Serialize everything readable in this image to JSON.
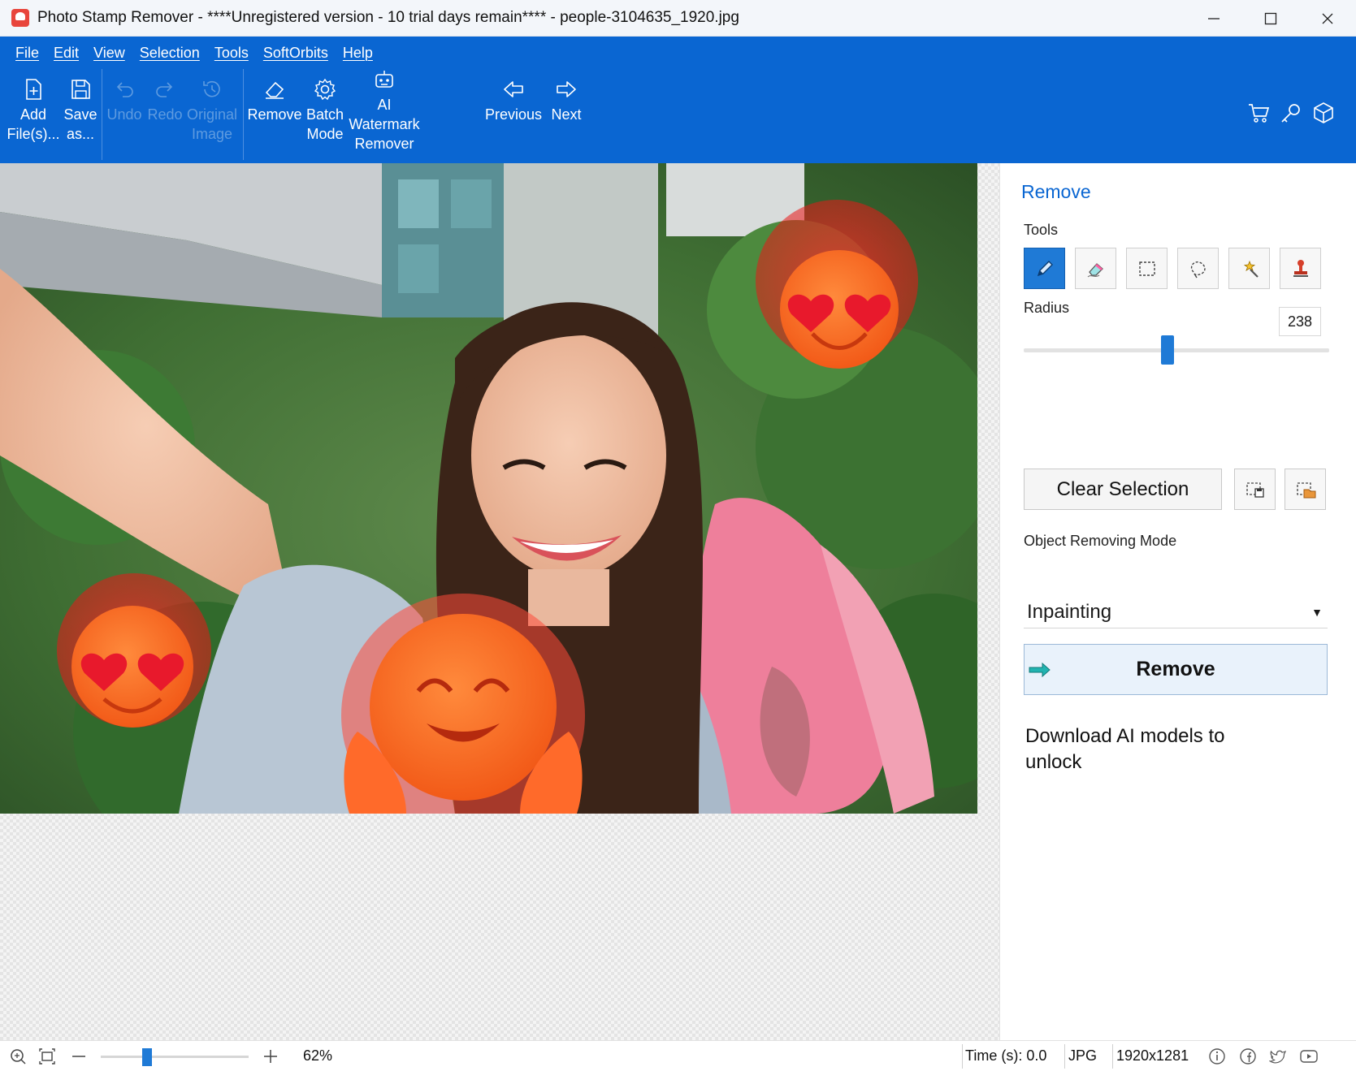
{
  "window": {
    "title": "Photo Stamp Remover - ****Unregistered version - 10 trial days remain**** - people-3104635_1920.jpg",
    "minimize_icon": "minimize-icon",
    "maximize_icon": "maximize-icon",
    "close_icon": "close-icon"
  },
  "menu": [
    "File",
    "Edit",
    "View",
    "Selection",
    "Tools",
    "SoftOrbits",
    "Help"
  ],
  "toolbar": {
    "add_files": {
      "line1": "Add",
      "line2": "File(s)...",
      "icon": "add-file-icon"
    },
    "save_as": {
      "line1": "Save",
      "line2": "as...",
      "icon": "save-icon"
    },
    "undo": {
      "label": "Undo",
      "icon": "undo-icon"
    },
    "redo": {
      "label": "Redo",
      "icon": "redo-icon"
    },
    "original_image": {
      "line1": "Original",
      "line2": "Image",
      "icon": "history-icon"
    },
    "remove": {
      "label": "Remove",
      "icon": "eraser-icon"
    },
    "batch_mode": {
      "line1": "Batch",
      "line2": "Mode",
      "icon": "gear-icon"
    },
    "ai_watermark": {
      "line1": "AI",
      "line2": "Watermark",
      "line3": "Remover",
      "icon": "robot-icon"
    },
    "previous": {
      "label": "Previous",
      "icon": "arrow-left-icon"
    },
    "next": {
      "label": "Next",
      "icon": "arrow-right-icon"
    },
    "right_icons": [
      "cart-icon",
      "key-icon",
      "box-icon"
    ]
  },
  "panel": {
    "title": "Remove",
    "tools_label": "Tools",
    "tools": [
      "pencil-icon",
      "eraser-icon",
      "rect-select-icon",
      "lasso-icon",
      "magic-wand-icon",
      "stamp-icon"
    ],
    "radius_label": "Radius",
    "radius_value": "238",
    "radius_fraction": 0.47,
    "clear_selection": "Clear Selection",
    "save_selection_icon": "save-selection-icon",
    "load_selection_icon": "load-selection-icon",
    "mode_label": "Object Removing Mode",
    "mode_value": "Inpainting",
    "remove_button": "Remove",
    "download_text": "Download AI models to unlock"
  },
  "status": {
    "zoom_level": "62%",
    "zoom_fraction": 0.3,
    "time": "Time (s): 0.0",
    "format": "JPG",
    "dimensions": "1920x1281"
  },
  "colors": {
    "accent": "#0a66d2",
    "ribbon": "#0a66d2",
    "active_tool": "#1f7ad6"
  }
}
